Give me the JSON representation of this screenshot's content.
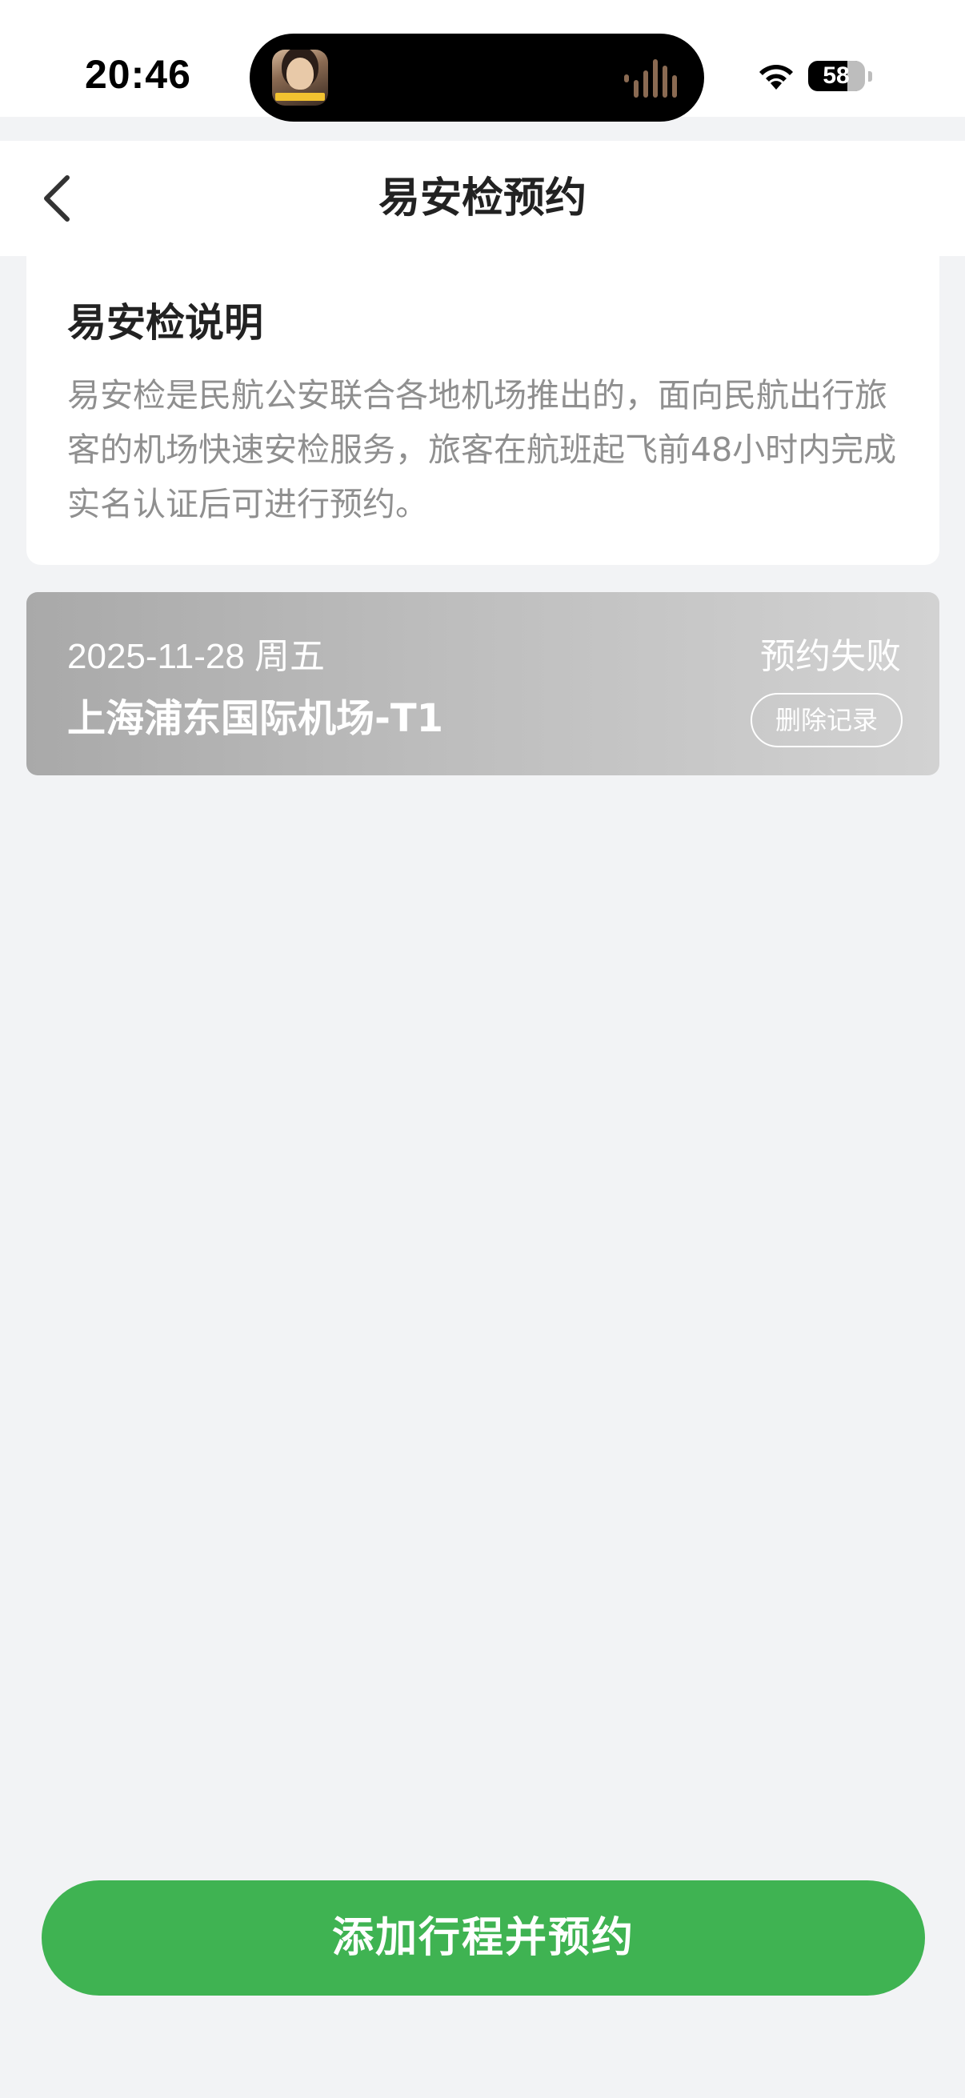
{
  "status_bar": {
    "time": "20:46",
    "battery": "58"
  },
  "nav": {
    "title": "易安检预约",
    "back_icon": "chevron-left-icon"
  },
  "info_card": {
    "title": "易安检说明",
    "description": "易安检是民航公安联合各地机场推出的，面向民航出行旅客的机场快速安检服务，旅客在航班起飞前48小时内完成实名认证后可进行预约。"
  },
  "records": [
    {
      "date": "2025-11-28 周五",
      "airport": "上海浦东国际机场-T1",
      "status": "预约失败",
      "delete_label": "删除记录"
    }
  ],
  "actions": {
    "primary_label": "添加行程并预约"
  },
  "colors": {
    "primary": "#3fb352",
    "page_background": "#f2f3f5",
    "record_card_failed": "#b8b8b8"
  }
}
